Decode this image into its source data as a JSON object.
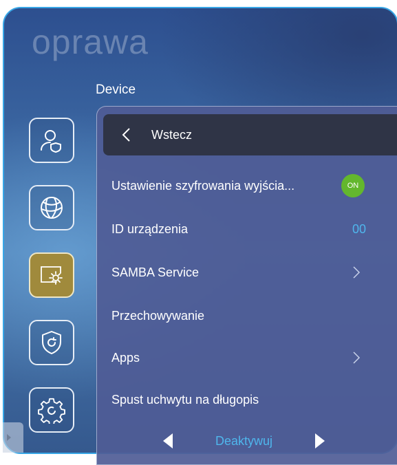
{
  "watermark": "oprawa",
  "section_title": "Device",
  "sidebar": {
    "items": [
      {
        "icon": "user-shield-icon",
        "active": false
      },
      {
        "icon": "globe-icon",
        "active": false
      },
      {
        "icon": "display-settings-icon",
        "active": true
      },
      {
        "icon": "shield-refresh-icon",
        "active": false
      },
      {
        "icon": "gear-refresh-icon",
        "active": false
      }
    ]
  },
  "back": {
    "label": "Wstecz"
  },
  "menu": {
    "encryption": {
      "label": "Ustawienie szyfrowania wyjścia...",
      "toggle": "ON"
    },
    "device_id": {
      "label": "ID urządzenia",
      "value": "00"
    },
    "samba": {
      "label": "SAMBA Service"
    },
    "storage": {
      "label": "Przechowywanie"
    },
    "apps": {
      "label": "Apps"
    },
    "pen_release": {
      "label": "Spust uchwytu na długopis",
      "value": "Deaktywuj"
    }
  },
  "colors": {
    "accent_blue": "#4fb6ec",
    "toggle_green": "#63b72d",
    "active_gold": "#a08a3c",
    "frame_border": "#37a6e6"
  }
}
